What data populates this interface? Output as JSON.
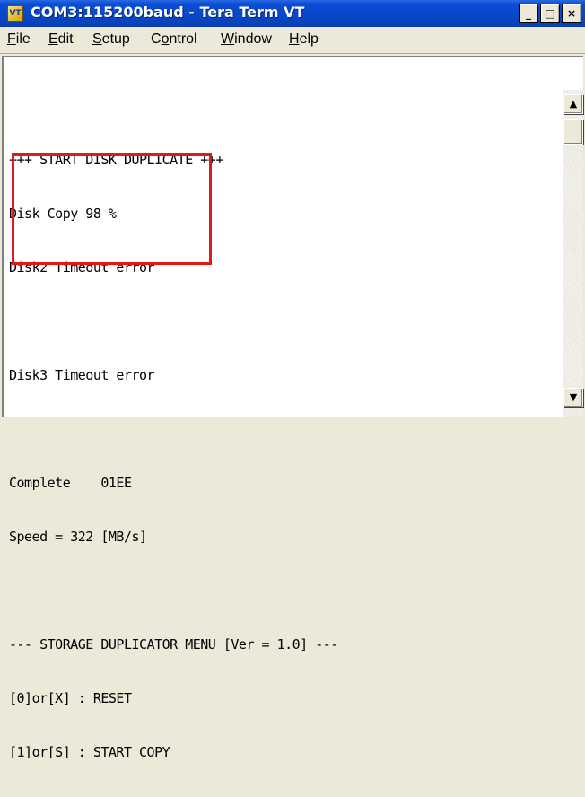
{
  "window": {
    "title": "COM3:115200baud - Tera Term VT",
    "icon": "tera-term-app-icon",
    "controls": {
      "minimize_glyph": "_",
      "maximize_glyph": "□",
      "close_glyph": "×"
    }
  },
  "menu": {
    "items": [
      {
        "accel": "F",
        "rest": "ile"
      },
      {
        "accel": "E",
        "rest": "dit"
      },
      {
        "accel": "S",
        "rest": "etup"
      },
      {
        "pre": "C",
        "accel": "o",
        "rest": "ntrol"
      },
      {
        "accel": "W",
        "rest": "indow"
      },
      {
        "accel": "H",
        "rest": "elp"
      }
    ]
  },
  "terminal": {
    "lines": [
      "+++ START DISK DUPLICATE +++",
      "Disk Copy 98 %",
      "Disk2 Timeout error",
      "",
      "Disk3 Timeout error",
      "",
      "Complete    01EE",
      "Speed = 322 [MB/s]",
      "",
      "--- STORAGE DUPLICATOR MENU [Ver = 1.0] ---",
      "[0]or[X] : RESET",
      "[1]or[S] : START COPY"
    ],
    "highlight_color": "#e01a1a"
  },
  "scrollbar": {
    "up_glyph": "▲",
    "down_glyph": "▼"
  }
}
